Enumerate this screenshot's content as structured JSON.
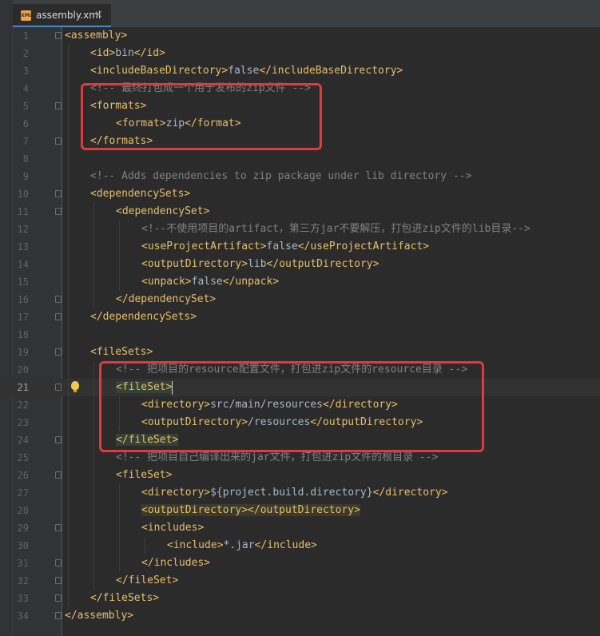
{
  "tab": {
    "file_name": "assembly.xml",
    "icon_text": "XML",
    "close": "×"
  },
  "lines": [
    {
      "n": "1",
      "code": [
        [
          "tag",
          "<assembly>"
        ]
      ]
    },
    {
      "n": "2",
      "code": [
        [
          "tag",
          "<id>"
        ],
        [
          "txt",
          "bin"
        ],
        [
          "tag",
          "</id>"
        ]
      ]
    },
    {
      "n": "3",
      "code": [
        [
          "tag",
          "<includeBaseDirectory>"
        ],
        [
          "txt",
          "false"
        ],
        [
          "tag",
          "</includeBaseDirectory>"
        ]
      ]
    },
    {
      "n": "4",
      "code": [
        [
          "cmt",
          "<!-- 最终打包成一个用于发布的zip文件 -->"
        ]
      ]
    },
    {
      "n": "5",
      "code": [
        [
          "tag",
          "<formats>"
        ]
      ]
    },
    {
      "n": "6",
      "code": [
        [
          "tag",
          "<format>"
        ],
        [
          "txt",
          "zip"
        ],
        [
          "tag",
          "</format>"
        ]
      ]
    },
    {
      "n": "7",
      "code": [
        [
          "tag",
          "</formats>"
        ]
      ]
    },
    {
      "n": "8",
      "code": []
    },
    {
      "n": "9",
      "code": [
        [
          "cmt",
          "<!-- Adds dependencies to zip package under lib directory -->"
        ]
      ]
    },
    {
      "n": "10",
      "code": [
        [
          "tag",
          "<dependencySets>"
        ]
      ]
    },
    {
      "n": "11",
      "code": [
        [
          "tag",
          "<dependencySet>"
        ]
      ]
    },
    {
      "n": "12",
      "code": [
        [
          "cmt",
          "<!--不使用项目的artifact，第三方jar不要解压，打包进zip文件的lib目录-->"
        ]
      ]
    },
    {
      "n": "13",
      "code": [
        [
          "tag",
          "<useProjectArtifact>"
        ],
        [
          "txt",
          "false"
        ],
        [
          "tag",
          "</useProjectArtifact>"
        ]
      ]
    },
    {
      "n": "14",
      "code": [
        [
          "tag",
          "<outputDirectory>"
        ],
        [
          "txt",
          "lib"
        ],
        [
          "tag",
          "</outputDirectory>"
        ]
      ]
    },
    {
      "n": "15",
      "code": [
        [
          "tag",
          "<unpack>"
        ],
        [
          "txt",
          "false"
        ],
        [
          "tag",
          "</unpack>"
        ]
      ]
    },
    {
      "n": "16",
      "code": [
        [
          "tag",
          "</dependencySet>"
        ]
      ]
    },
    {
      "n": "17",
      "code": [
        [
          "tag",
          "</dependencySets>"
        ]
      ]
    },
    {
      "n": "18",
      "code": []
    },
    {
      "n": "19",
      "code": [
        [
          "tag",
          "<fileSets>"
        ]
      ]
    },
    {
      "n": "20",
      "code": [
        [
          "cmt",
          "<!-- 把项目的resource配置文件，打包进zip文件的resource目录 -->"
        ]
      ]
    },
    {
      "n": "21",
      "code": [
        [
          "tag hl-green",
          "<fileSet>"
        ]
      ]
    },
    {
      "n": "22",
      "code": [
        [
          "tag",
          "<directory>"
        ],
        [
          "txt",
          "src/main/resources"
        ],
        [
          "tag",
          "</directory>"
        ]
      ]
    },
    {
      "n": "23",
      "code": [
        [
          "tag",
          "<outputDirectory>"
        ],
        [
          "txt",
          "/resources"
        ],
        [
          "tag",
          "</outputDirectory>"
        ]
      ]
    },
    {
      "n": "24",
      "code": [
        [
          "tag hl-green",
          "</fileSet>"
        ]
      ]
    },
    {
      "n": "25",
      "code": [
        [
          "cmt",
          "<!-- 把项目自己编译出来的jar文件，打包进zip文件的根目录 -->"
        ]
      ]
    },
    {
      "n": "26",
      "code": [
        [
          "tag",
          "<fileSet>"
        ]
      ]
    },
    {
      "n": "27",
      "code": [
        [
          "tag",
          "<directory>"
        ],
        [
          "txt",
          "${project.build.directory}"
        ],
        [
          "tag",
          "</directory>"
        ]
      ]
    },
    {
      "n": "28",
      "code": [
        [
          "tag hl-yellow",
          "<outputDirectory></outputDirectory>"
        ]
      ]
    },
    {
      "n": "29",
      "code": [
        [
          "tag",
          "<includes>"
        ]
      ]
    },
    {
      "n": "30",
      "code": [
        [
          "tag",
          "<include>"
        ],
        [
          "txt",
          "*.jar"
        ],
        [
          "tag",
          "</include>"
        ]
      ]
    },
    {
      "n": "31",
      "code": [
        [
          "tag",
          "</includes>"
        ]
      ]
    },
    {
      "n": "32",
      "code": [
        [
          "tag",
          "</fileSet>"
        ]
      ]
    },
    {
      "n": "33",
      "code": [
        [
          "tag",
          "</fileSets>"
        ]
      ]
    },
    {
      "n": "34",
      "code": [
        [
          "tag",
          "</assembly>"
        ]
      ]
    }
  ]
}
